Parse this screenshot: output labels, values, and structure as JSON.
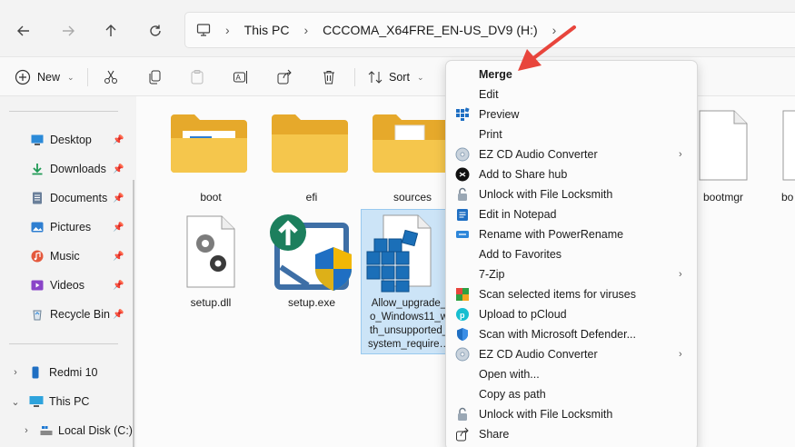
{
  "address": {
    "crumbs": [
      "This PC",
      "CCCOMA_X64FRE_EN-US_DV9 (H:)"
    ]
  },
  "toolbar": {
    "new_label": "New",
    "sort_label": "Sort"
  },
  "sidebar": {
    "quick_access": [
      {
        "label": "Desktop",
        "icon": "desktop-icon"
      },
      {
        "label": "Downloads",
        "icon": "download-icon"
      },
      {
        "label": "Documents",
        "icon": "documents-icon"
      },
      {
        "label": "Pictures",
        "icon": "pictures-icon"
      },
      {
        "label": "Music",
        "icon": "music-icon"
      },
      {
        "label": "Videos",
        "icon": "videos-icon"
      },
      {
        "label": "Recycle Bin",
        "icon": "recycle-bin-icon"
      }
    ],
    "tree": [
      {
        "label": "Redmi 10",
        "icon": "phone-icon"
      },
      {
        "label": "This PC",
        "icon": "computer-icon"
      },
      {
        "label": "Local Disk (C:)",
        "icon": "drive-icon"
      }
    ]
  },
  "files": [
    {
      "name": "boot",
      "type": "folder"
    },
    {
      "name": "efi",
      "type": "folder"
    },
    {
      "name": "sources",
      "type": "folder"
    },
    {
      "name": "bootmgr",
      "type": "file"
    },
    {
      "name": "bo",
      "type": "file"
    },
    {
      "name": "setup.dll",
      "type": "dll"
    },
    {
      "name": "setup.exe",
      "type": "exe"
    },
    {
      "name_lines": [
        "Allow_upgrade_",
        "o_Windows11_w",
        "th_unsupported_",
        "system_require…"
      ],
      "type": "reg",
      "selected": true
    }
  ],
  "context_menu": {
    "items": [
      {
        "label": "Merge",
        "bold": true,
        "icon": "none"
      },
      {
        "label": "Edit",
        "icon": "none"
      },
      {
        "label": "Preview",
        "icon": "preview-icon"
      },
      {
        "label": "Print",
        "icon": "none"
      },
      {
        "label": "EZ CD Audio Converter",
        "icon": "cd-icon",
        "submenu": true
      },
      {
        "label": "Add to Share hub",
        "icon": "share-hub-icon"
      },
      {
        "label": "Unlock with File Locksmith",
        "icon": "lock-icon"
      },
      {
        "label": "Edit in Notepad",
        "icon": "notepad-icon"
      },
      {
        "label": "Rename with PowerRename",
        "icon": "powerrename-icon"
      },
      {
        "label": "Add to Favorites",
        "icon": "none"
      },
      {
        "label": "7-Zip",
        "icon": "none",
        "submenu": true
      },
      {
        "label": "Scan selected items for viruses",
        "icon": "antivirus-icon"
      },
      {
        "label": "Upload to pCloud",
        "icon": "pcloud-icon"
      },
      {
        "label": "Scan with Microsoft Defender...",
        "icon": "defender-icon"
      },
      {
        "label": "EZ CD Audio Converter",
        "icon": "cd-icon",
        "submenu": true
      },
      {
        "label": "Open with...",
        "icon": "none"
      },
      {
        "label": "Copy as path",
        "icon": "none"
      },
      {
        "label": "Unlock with File Locksmith",
        "icon": "lock-icon"
      },
      {
        "label": "Share",
        "icon": "share-icon"
      }
    ]
  },
  "colors": {
    "accent": "#0067c0",
    "folder": "#f0c44c",
    "annotation_arrow": "#e8453c"
  }
}
